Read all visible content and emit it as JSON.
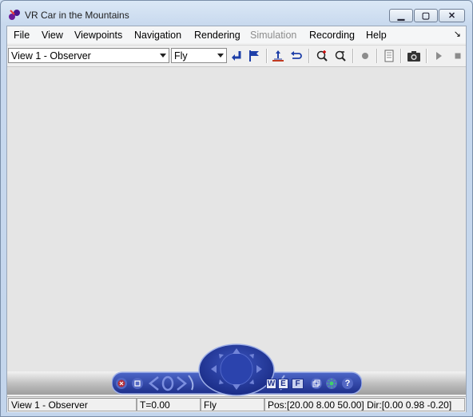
{
  "window": {
    "title": "VR Car in the Mountains"
  },
  "menubar": {
    "items": [
      "File",
      "View",
      "Viewpoints",
      "Navigation",
      "Rendering",
      "Simulation",
      "Recording",
      "Help"
    ]
  },
  "toolbar": {
    "viewpoint_value": "View 1 - Observer",
    "navmode_value": "Fly"
  },
  "navpanel": {
    "wireframe_label": "W",
    "ortho_label": "E",
    "fog_label": "F",
    "help_label": "?"
  },
  "statusbar": {
    "viewpoint": "View 1 - Observer",
    "time": "T=0.00",
    "mode": "Fly",
    "position": "Pos:[20.00 8.00 50.00] Dir:[0.00 0.98 -0.20]"
  },
  "colors": {
    "nav_panel": "#2a3f9e",
    "accent_blue": "#1e3fa8",
    "viewport_bg": "#e5e5e5"
  }
}
